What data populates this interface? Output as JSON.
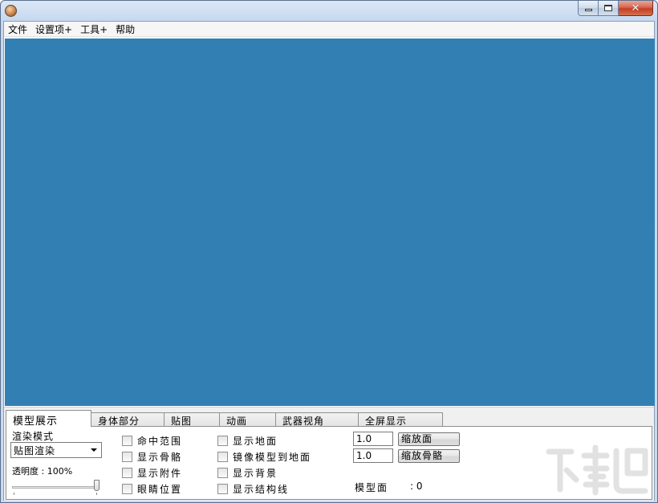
{
  "menu": [
    "文件",
    "设置项+",
    "工具+",
    "帮助"
  ],
  "window_buttons": {
    "close_glyph": "✕"
  },
  "tabs": [
    "模型展示",
    "身体部分",
    "贴图",
    "动画",
    "武器视角",
    "全屏显示"
  ],
  "render": {
    "label": "渲染模式",
    "selected": "贴图渲染",
    "opacity_label": "透明度 : 100%",
    "opacity_value": 100
  },
  "checkboxes_col1": [
    "命中范围",
    "显示骨骼",
    "显示附件",
    "眼睛位置"
  ],
  "checkboxes_col2": [
    "显示地面",
    "镜像模型到地面",
    "显示背景",
    "显示结构线"
  ],
  "scale": {
    "face_value": "1.0",
    "face_button": "缩放面",
    "bone_value": "1.0",
    "bone_button": "缩放骨骼"
  },
  "model_faces": {
    "label": "模型面",
    "value": ": 0"
  },
  "colors": {
    "viewport": "#3280b3"
  }
}
